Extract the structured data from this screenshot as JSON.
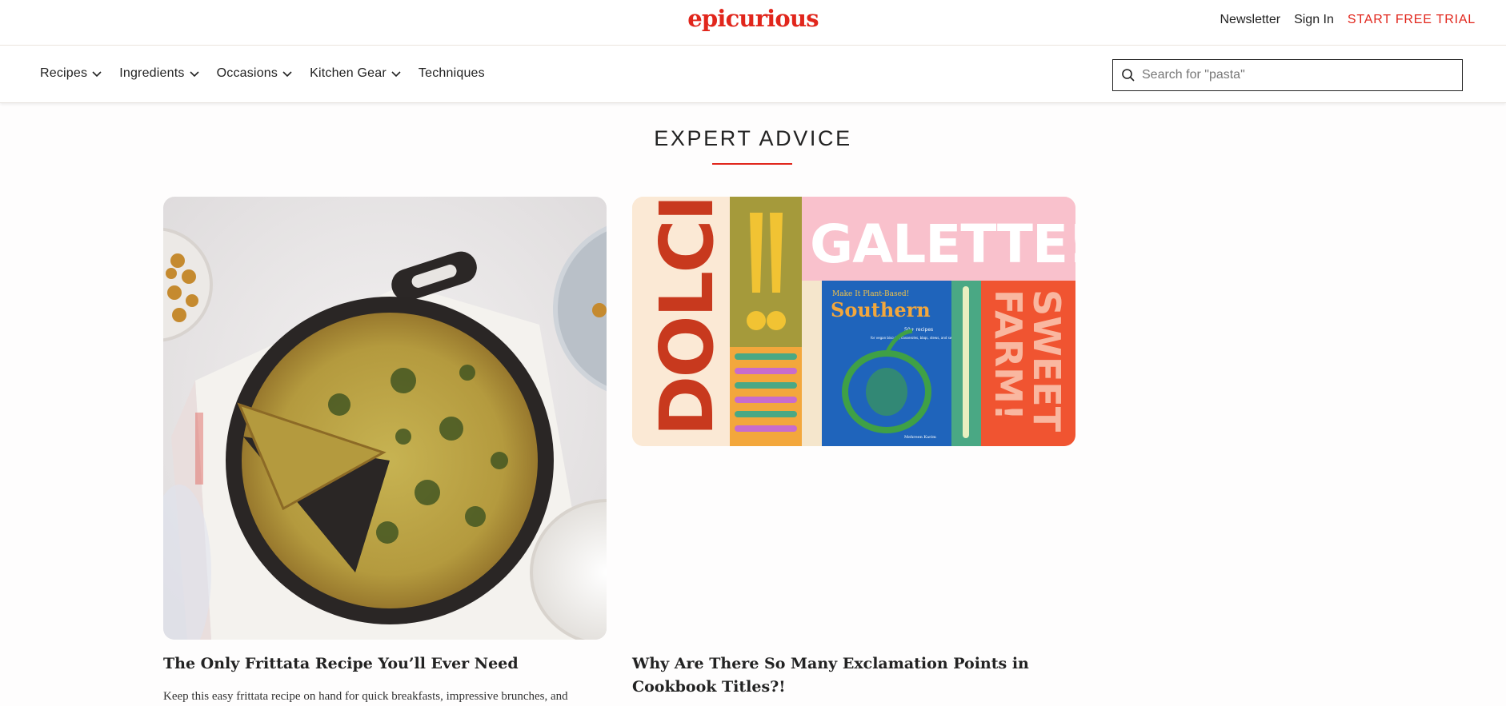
{
  "header": {
    "logo": "epicurious",
    "links": {
      "newsletter": "Newsletter",
      "sign_in": "Sign In",
      "trial": "START FREE TRIAL"
    },
    "accent_color": "#e1261c"
  },
  "nav": {
    "items": [
      {
        "label": "Recipes",
        "has_dropdown": true
      },
      {
        "label": "Ingredients",
        "has_dropdown": true
      },
      {
        "label": "Occasions",
        "has_dropdown": true
      },
      {
        "label": "Kitchen Gear",
        "has_dropdown": true
      },
      {
        "label": "Techniques",
        "has_dropdown": false
      }
    ],
    "search": {
      "placeholder": "Search for \"pasta\"",
      "value": ""
    }
  },
  "section": {
    "title": "EXPERT ADVICE"
  },
  "cards": [
    {
      "headline": "The Only Frittata Recipe You’ll Ever Need",
      "dek": "Keep this easy frittata recipe on hand for quick breakfasts, impressive brunches, and",
      "image": "frittata-in-cast-iron-skillet"
    },
    {
      "headline": "Why Are There So Many Exclamation Points in Cookbook Titles?!",
      "dek": "",
      "image": "cookbook-covers-collage",
      "image_text": {
        "dolci": "DOLCI!",
        "galette": "GALETTE!",
        "plant_based": "Make It Plant-Based!",
        "southern": "Southern",
        "recipes_line": "50+ recipes",
        "recipes_sub": "for vegan biscuits, casseroles, bbqs, stews, and sweets",
        "author": "Mehreen Karim",
        "sweet": "SWEET",
        "farm": "FARM!"
      }
    }
  ]
}
